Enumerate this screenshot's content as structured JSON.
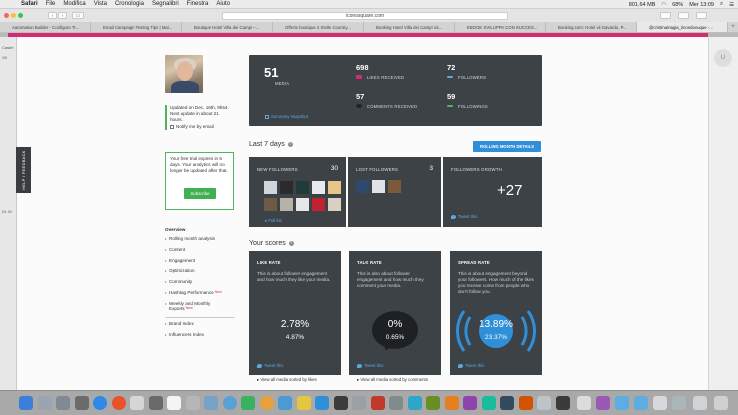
{
  "menubar": {
    "app": "Safari",
    "items": [
      "File",
      "Modifica",
      "Vista",
      "Cronologia",
      "Segnalibri",
      "Finestra",
      "Aiuto"
    ],
    "memory": "801.64 MB",
    "battery": "68%",
    "clock": "Mer 13:09"
  },
  "browser": {
    "url": "iconosquare.com",
    "tabs": [
      "Automation Builder - Configure Tr...",
      "Email Campaign Testing Tips | Mai...",
      "Boutique Hotel Villa dei Campi –...",
      "Offerte boutique 4 Stelle Country...",
      "Booking Hotel Villa dei Campi vic...",
      "EBOOK SVILUPPA CON SUCCES...",
      "Booking.com: Hotel vii Gavardo, P...",
      "@cristinamagia_linondovuque -..."
    ]
  },
  "sidebar": {
    "feedback_label": "HELP / FEEDBACK",
    "left_fragments": [
      "Castel",
      "Gli",
      "Dr. M"
    ],
    "updated_line1": "Updated on Dec, 16th, 9h54.",
    "updated_line2": "Next update in about 21",
    "updated_line3": "hours.",
    "notify_label": "Notify me by email",
    "trial_text": "Your free trial expires in 6 days. Your analytics will no longer be updated after that.",
    "subscribe_label": "Subscribe",
    "menu_title": "Overview",
    "menu": [
      {
        "label": "Rolling month analysis",
        "badge": ""
      },
      {
        "label": "Content",
        "badge": ""
      },
      {
        "label": "Engagement",
        "badge": ""
      },
      {
        "label": "Optimization",
        "badge": ""
      },
      {
        "label": "Community",
        "badge": ""
      },
      {
        "label": "Hashtag Performance",
        "badge": "New"
      },
      {
        "label": "Weekly and Monthly Exports",
        "badge": "New"
      }
    ],
    "menu2": [
      "Brand Index",
      "Influencers Index"
    ]
  },
  "stats": {
    "media_count": "51",
    "media_label": "MEDIA",
    "likes_count": "698",
    "likes_label": "LIKES RECEIVED",
    "comments_count": "57",
    "comments_label": "COMMENTS RECEIVED",
    "followers_count": "72",
    "followers_label": "FOLLOWERS",
    "followings_count": "59",
    "followings_label": "FOLLOWINGS",
    "snapshot_label": "Summary snapshot"
  },
  "last7": {
    "title": "Last 7 days",
    "rolling_button": "ROLLING MONTH DETAILS",
    "new_followers_label": "NEW FOLLOWERS",
    "new_followers_count": "30",
    "full_list": "Full list",
    "lost_followers_label": "LOST FOLLOWERS",
    "lost_followers_count": "3",
    "growth_label": "FOLLOWERS GROWTH",
    "growth_value": "+27",
    "tweet_label": "Tweet this"
  },
  "scores": {
    "title": "Your scores",
    "like": {
      "title": "LIKE RATE",
      "desc": "This is about follower engagement and how much they like your media.",
      "value": "2.78%",
      "sub": "4.87%",
      "tweet": "Tweet this",
      "link": "View all media sorted by likes"
    },
    "talk": {
      "title": "TALK RATE",
      "desc": "This is also about follower engagement and how much they comment your media.",
      "value": "0%",
      "sub": "0.65%",
      "tweet": "Tweet this",
      "link": "View all media sorted by comments"
    },
    "spread": {
      "title": "SPREAD RATE",
      "desc": "This is about engagement beyond your followers. How much of the likes you receive come from people who don't follow you.",
      "value": "13.89%",
      "sub": "23.37%",
      "tweet": "Tweet this"
    }
  },
  "colors": {
    "accent_pink": "#d22d72",
    "panel_dark": "#3d4247",
    "link_blue": "#5aa8e0",
    "button_blue": "#2f8fd9",
    "success_green": "#43b04f"
  }
}
